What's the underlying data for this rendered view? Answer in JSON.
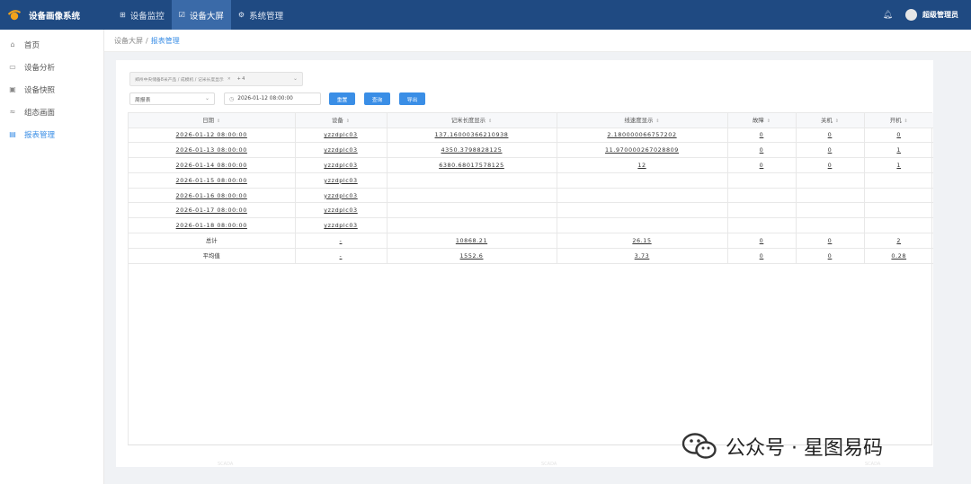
{
  "app": {
    "title": "设备画像系统"
  },
  "topnav": [
    {
      "label": "设备监控",
      "icon": "monitor-icon",
      "active": false
    },
    {
      "label": "设备大屏",
      "icon": "dashboard-icon",
      "active": true
    },
    {
      "label": "系统管理",
      "icon": "settings-icon",
      "active": false
    }
  ],
  "user": {
    "name": "超级管理员"
  },
  "sidebar": {
    "items": [
      {
        "label": "首页",
        "icon": "home-icon",
        "active": false
      },
      {
        "label": "设备分析",
        "icon": "analysis-icon",
        "active": false
      },
      {
        "label": "设备快照",
        "icon": "snapshot-icon",
        "active": false
      },
      {
        "label": "组态画面",
        "icon": "scada-icon",
        "active": false
      },
      {
        "label": "报表管理",
        "icon": "report-icon",
        "active": true
      }
    ]
  },
  "breadcrumb": {
    "parent": "设备大屏",
    "separator": "/",
    "current": "报表管理"
  },
  "filters": {
    "device_path": "郑州中央储备8米产品 / 成模机 / 记米长度显示",
    "more_count": "+ 4",
    "report_type": "周报表",
    "date": "2026-01-12 08:00:00"
  },
  "buttons": {
    "reset": "重置",
    "query": "查询",
    "export": "导出"
  },
  "table": {
    "columns": [
      "日期",
      "设备",
      "记米长度显示",
      "线速度显示",
      "故障",
      "关机",
      "开机"
    ],
    "rows": [
      [
        "2026-01-12 08:00:00",
        "yzzdplc03",
        "137.16000366210938",
        "2.180000066757202",
        "0",
        "0",
        "0"
      ],
      [
        "2026-01-13 08:00:00",
        "yzzdplc03",
        "4350.3798828125",
        "11.970000267028809",
        "0",
        "0",
        "1"
      ],
      [
        "2026-01-14 08:00:00",
        "yzzdplc03",
        "6380.68017578125",
        "12",
        "0",
        "0",
        "1"
      ],
      [
        "2026-01-15 08:00:00",
        "yzzdplc03",
        "",
        "",
        "",
        "",
        ""
      ],
      [
        "2026-01-16 08:00:00",
        "yzzdplc03",
        "",
        "",
        "",
        "",
        ""
      ],
      [
        "2026-01-17 08:00:00",
        "yzzdplc03",
        "",
        "",
        "",
        "",
        ""
      ],
      [
        "2026-01-18 08:00:00",
        "yzzdplc03",
        "",
        "",
        "",
        "",
        ""
      ],
      [
        "总计",
        "-",
        "10868.21",
        "26.15",
        "0",
        "0",
        "2"
      ],
      [
        "平均值",
        "-",
        "1552.6",
        "3.73",
        "0",
        "0",
        "0.28"
      ]
    ]
  },
  "watermark": {
    "text": "公众号 · 星图易码",
    "faint": "SCADA"
  },
  "colors": {
    "topbar": "#1f4a82",
    "accent": "#3a8ee6",
    "active_nav": "#3a6aa8"
  }
}
